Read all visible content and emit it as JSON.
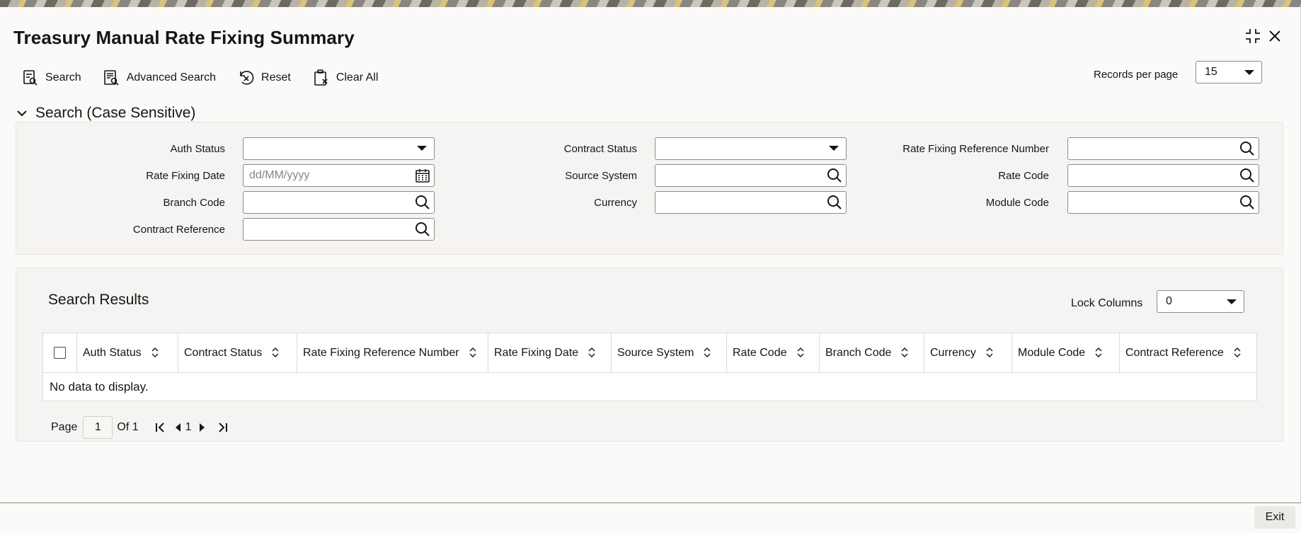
{
  "window": {
    "title": "Treasury Manual Rate Fixing Summary"
  },
  "toolbar": {
    "search": "Search",
    "advanced_search": "Advanced Search",
    "reset": "Reset",
    "clear_all": "Clear All"
  },
  "records_per_page": {
    "label": "Records per page",
    "value": "15"
  },
  "search_section": {
    "title": "Search (Case Sensitive)"
  },
  "fields": {
    "auth_status": {
      "label": "Auth Status",
      "value": ""
    },
    "rate_fixing_date": {
      "label": "Rate Fixing Date",
      "placeholder": "dd/MM/yyyy"
    },
    "branch_code": {
      "label": "Branch Code",
      "value": ""
    },
    "contract_reference": {
      "label": "Contract Reference",
      "value": ""
    },
    "contract_status": {
      "label": "Contract Status",
      "value": ""
    },
    "source_system": {
      "label": "Source System",
      "value": ""
    },
    "currency": {
      "label": "Currency",
      "value": ""
    },
    "rate_fixing_reference_number": {
      "label": "Rate Fixing Reference Number",
      "value": ""
    },
    "rate_code": {
      "label": "Rate Code",
      "value": ""
    },
    "module_code": {
      "label": "Module Code",
      "value": ""
    }
  },
  "results": {
    "title": "Search Results",
    "lock_columns_label": "Lock Columns",
    "lock_columns_value": "0",
    "columns": [
      "Auth Status",
      "Contract Status",
      "Rate Fixing Reference Number",
      "Rate Fixing Date",
      "Source System",
      "Rate Code",
      "Branch Code",
      "Currency",
      "Module Code",
      "Contract Reference"
    ],
    "empty_message": "No data to display."
  },
  "pager": {
    "page_label": "Page",
    "page_value": "1",
    "of_label": "Of 1",
    "current": "1"
  },
  "footer": {
    "exit": "Exit"
  }
}
